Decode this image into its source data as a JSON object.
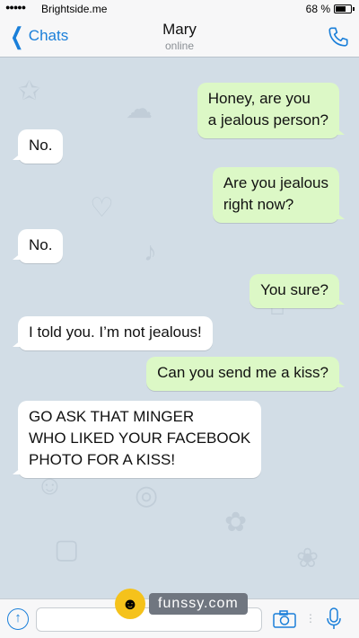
{
  "status_bar": {
    "signal": "●●●●●",
    "carrier": "Brightside.me",
    "battery": "68 %",
    "battery_level": 0.68
  },
  "nav": {
    "back_label": "Chats",
    "title": "Mary",
    "subtitle": "online"
  },
  "messages": [
    {
      "side": "out",
      "text": "Honey, are you\na jealous person?"
    },
    {
      "side": "in",
      "text": "No."
    },
    {
      "side": "out",
      "text": "Are you jealous\nright now?"
    },
    {
      "side": "in",
      "text": "No."
    },
    {
      "side": "out",
      "text": "You sure?"
    },
    {
      "side": "in",
      "text": "I told you. I’m not jealous!"
    },
    {
      "side": "out",
      "text": "Can you send me a kiss?"
    },
    {
      "side": "in",
      "text": "GO ASK THAT MINGER\nWHO LIKED YOUR FACEBOOK\nPHOTO FOR A KISS!"
    }
  ],
  "input": {
    "placeholder": "",
    "value": ""
  },
  "watermark": {
    "text": "funssy.com"
  },
  "colors": {
    "accent": "#1a7fd9",
    "outgoing_bubble": "#dcf8c6",
    "incoming_bubble": "#ffffff",
    "chat_background": "#d2dde6"
  },
  "icons": {
    "back": "chevron-left-icon",
    "call": "phone-icon",
    "attach": "upload-icon",
    "camera": "camera-icon",
    "mic": "microphone-icon"
  }
}
